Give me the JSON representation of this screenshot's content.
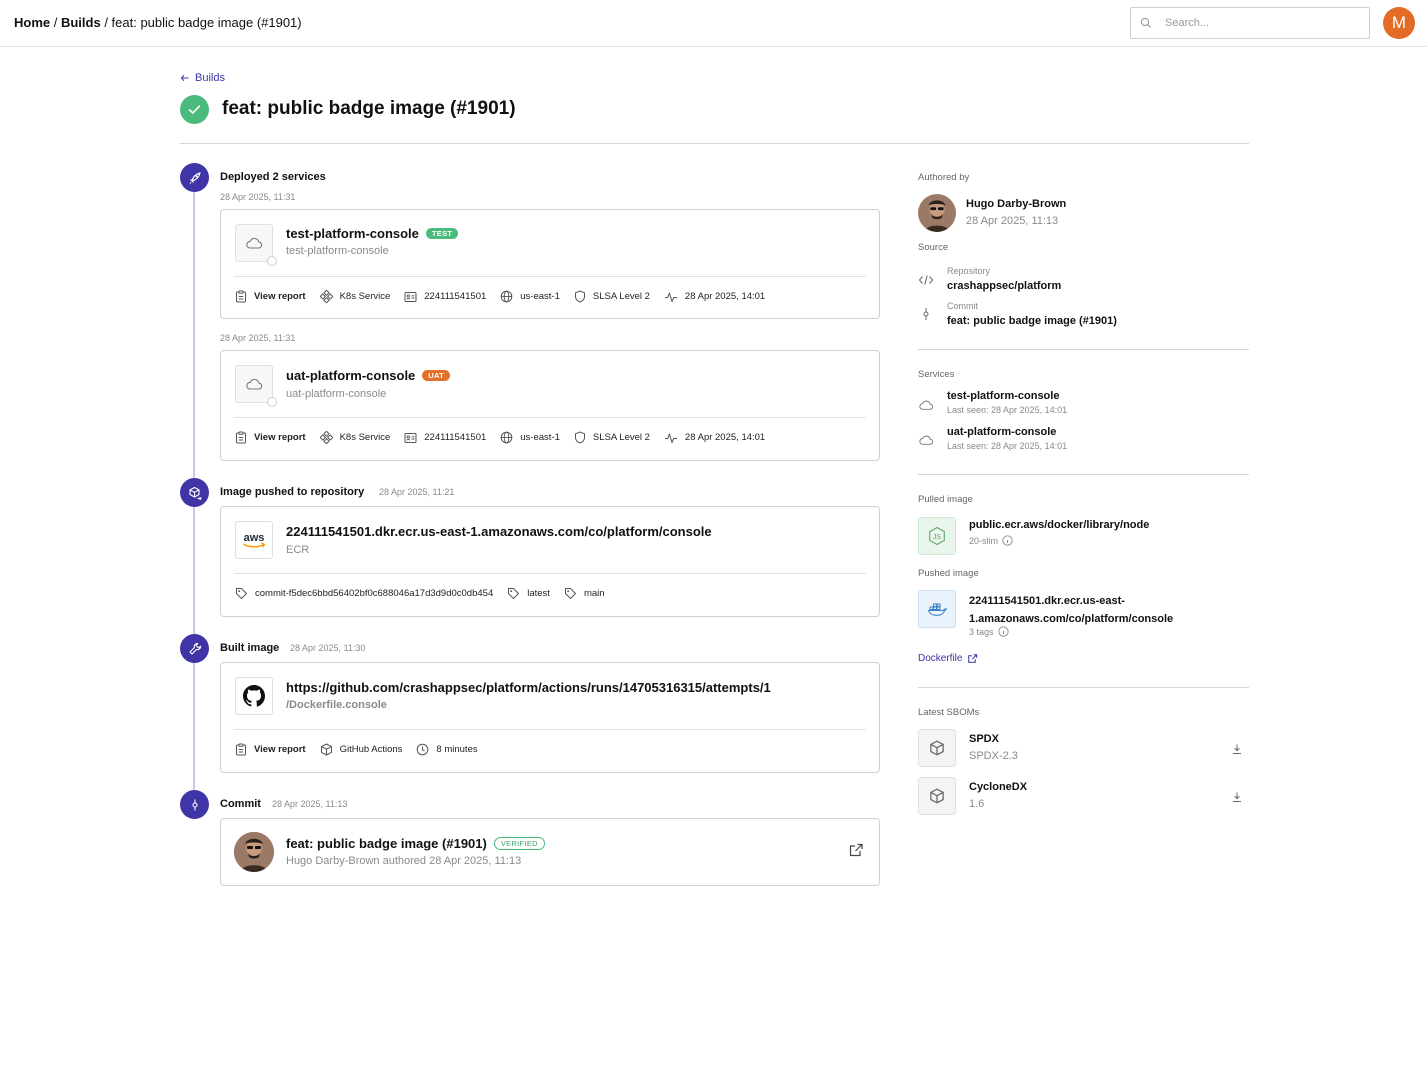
{
  "header": {
    "breadcrumb_home": "Home",
    "breadcrumb_builds": "Builds",
    "breadcrumb_current": "feat: public badge image (#1901)",
    "search_placeholder": "Search...",
    "avatar_initial": "M"
  },
  "page": {
    "back_label": "Builds",
    "title": "feat: public badge image (#1901)"
  },
  "timeline": {
    "deployed": {
      "title": "Deployed 2 services",
      "time": "28 Apr 2025, 11:31",
      "services": [
        {
          "time": "28 Apr 2025, 11:31",
          "name": "test-platform-console",
          "badge": "TEST",
          "sub": "test-platform-console",
          "view_report": "View report",
          "type": "K8s Service",
          "account": "224111541501",
          "region": "us-east-1",
          "slsa": "SLSA Level 2",
          "last_seen": "28 Apr 2025, 14:01"
        },
        {
          "time": "28 Apr 2025, 11:31",
          "name": "uat-platform-console",
          "badge": "UAT",
          "sub": "uat-platform-console",
          "view_report": "View report",
          "type": "K8s Service",
          "account": "224111541501",
          "region": "us-east-1",
          "slsa": "SLSA Level 2",
          "last_seen": "28 Apr 2025, 14:01"
        }
      ]
    },
    "pushed": {
      "title": "Image pushed to repository",
      "time": "28 Apr 2025, 11:21",
      "aws_logo": "aws",
      "repo": "224111541501.dkr.ecr.us-east-1.amazonaws.com/co/platform/console",
      "registry": "ECR",
      "tags": [
        "commit-f5dec6bbd56402bf0c688046a17d3d9d0c0db454",
        "latest",
        "main"
      ]
    },
    "built": {
      "title": "Built image",
      "time": "28 Apr 2025, 11:30",
      "url": "https://github.com/crashappsec/platform/actions/runs/14705316315/attempts/1",
      "dockerfile": "/Dockerfile.console",
      "view_report": "View report",
      "ci": "GitHub Actions",
      "duration": "8 minutes"
    },
    "commit": {
      "title": "Commit",
      "time": "28 Apr 2025, 11:13",
      "message": "feat: public badge image (#1901)",
      "badge": "VERIFIED",
      "byline": "Hugo Darby-Brown authored 28 Apr 2025, 11:13"
    }
  },
  "sidebar": {
    "authored_by_label": "Authored by",
    "author_name": "Hugo Darby-Brown",
    "author_time": "28 Apr 2025, 11:13",
    "source_label": "Source",
    "repository_label": "Repository",
    "repository": "crashappsec/platform",
    "commit_label": "Commit",
    "commit": "feat: public badge image (#1901)",
    "services_label": "Services",
    "services": [
      {
        "name": "test-platform-console",
        "last_seen": "Last seen: 28 Apr 2025, 14:01"
      },
      {
        "name": "uat-platform-console",
        "last_seen": "Last seen: 28 Apr 2025, 14:01"
      }
    ],
    "pulled_image_label": "Pulled image",
    "pulled_image": "public.ecr.aws/docker/library/node",
    "pulled_tag": "20-slim",
    "pushed_image_label": "Pushed image",
    "pushed_image_line1": "224111541501.dkr.ecr.us-east-",
    "pushed_image_line2": "1.amazonaws.com/co/platform/console",
    "pushed_tags": "3 tags",
    "dockerfile_link": "Dockerfile",
    "sboms_label": "Latest SBOMs",
    "sboms": [
      {
        "name": "SPDX",
        "version": "SPDX-2.3"
      },
      {
        "name": "CycloneDX",
        "version": "1.6"
      }
    ]
  },
  "colors": {
    "accent": "#3f35a6",
    "success": "#4bba7d",
    "uat": "#e2702b",
    "avatar": "#e36b25"
  }
}
